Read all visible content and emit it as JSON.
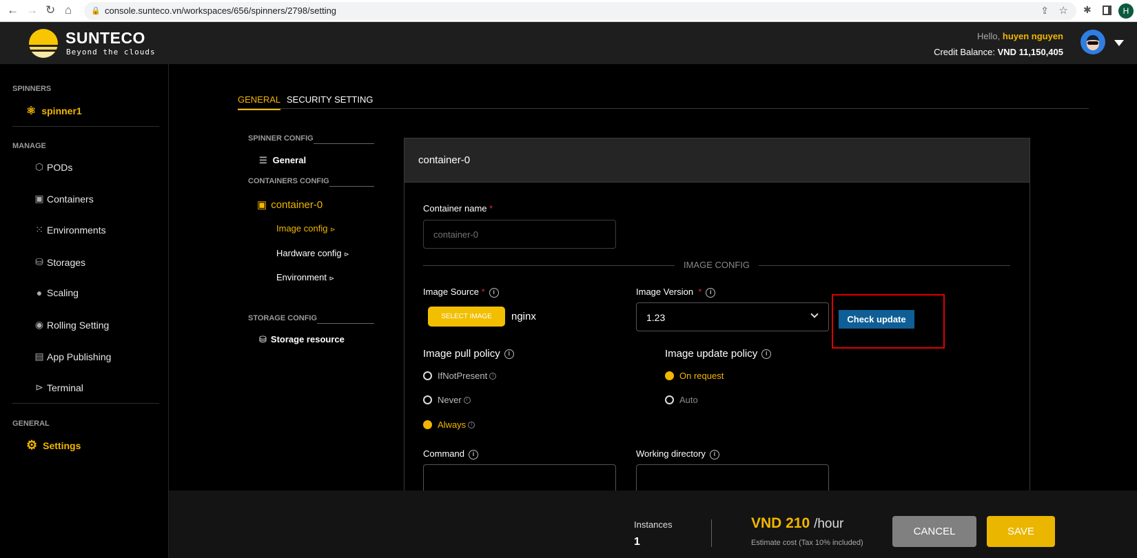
{
  "browser": {
    "url": "console.sunteco.vn/workspaces/656/spinners/2798/setting",
    "profile_initial": "H"
  },
  "header": {
    "brand": "SUNTECO",
    "tagline": "Beyond the clouds",
    "hello": "Hello,",
    "user": "huyen nguyen",
    "credit_label": "Credit Balance:",
    "credit_value": "VND 11,150,405"
  },
  "sidebar": {
    "spinners_title": "SPINNERS",
    "spinner": "spinner1",
    "manage_title": "MANAGE",
    "items": [
      {
        "label": "PODs",
        "icon": "pods-icon"
      },
      {
        "label": "Containers",
        "icon": "box-icon"
      },
      {
        "label": "Environments",
        "icon": "dots-grid-icon"
      },
      {
        "label": "Storages",
        "icon": "database-icon"
      },
      {
        "label": "Scaling",
        "icon": "scaling-icon"
      },
      {
        "label": "Rolling Setting",
        "icon": "rolling-icon"
      },
      {
        "label": "App Publishing",
        "icon": "publish-icon"
      },
      {
        "label": "Terminal",
        "icon": "terminal-icon"
      }
    ],
    "general_title": "GENERAL",
    "settings": "Settings"
  },
  "tabs": [
    {
      "label": "GENERAL",
      "active": true
    },
    {
      "label": "SECURITY SETTING",
      "active": false
    }
  ],
  "config_nav": {
    "spinner_config": "SPINNER CONFIG",
    "general": "General",
    "containers_config": "CONTAINERS CONFIG",
    "container": "container-0",
    "image_config": "Image config",
    "hardware_config": "Hardware config",
    "environment": "Environment",
    "storage_config": "STORAGE CONFIG",
    "storage_resource": "Storage resource"
  },
  "card": {
    "title": "container-0",
    "container_name_label": "Container name",
    "container_name_placeholder": "container-0",
    "image_config_divider": "IMAGE CONFIG",
    "image_source_label": "Image Source",
    "select_image": "SELECT IMAGE",
    "image_name": "nginx",
    "image_version_label": "Image Version",
    "image_version": "1.23",
    "check_update": "Check update",
    "pull_policy_label": "Image pull policy",
    "pull_options": [
      {
        "label": "IfNotPresent",
        "selected": false
      },
      {
        "label": "Never",
        "selected": false
      },
      {
        "label": "Always",
        "selected": true
      }
    ],
    "update_policy_label": "Image update policy",
    "update_options": [
      {
        "label": "On request",
        "selected": true
      },
      {
        "label": "Auto",
        "selected": false
      }
    ],
    "command_label": "Command",
    "workdir_label": "Working directory"
  },
  "footer": {
    "instances_label": "Instances",
    "instances": "1",
    "price": "VND 210",
    "per": "/hour",
    "estimate": "Estimate cost (Tax 10% included)",
    "cancel": "CANCEL",
    "save": "SAVE"
  },
  "colors": {
    "accent": "#f2b600",
    "check_update": "#0f5f96",
    "highlight_box": "#e00000"
  }
}
